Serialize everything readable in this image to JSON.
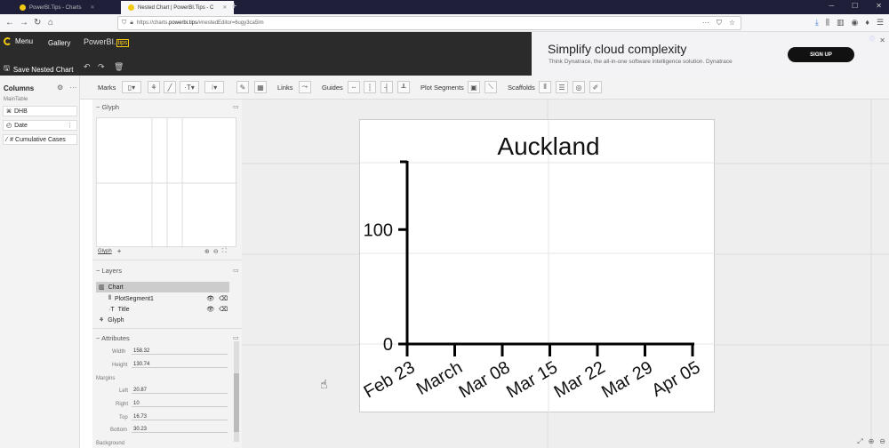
{
  "browser": {
    "tabs": [
      {
        "title": "PowerBI.Tips - Charts",
        "active": false
      },
      {
        "title": "Nested Chart | PowerBI.Tips - C",
        "active": true
      }
    ],
    "url_prefix": "https://charts.",
    "url_domain": "powerbi.tips",
    "url_path": "/#nestedEditor=6ugy3ca5lm",
    "url_more": "···"
  },
  "app": {
    "menu_label": "Menu",
    "gallery_label": "Gallery",
    "brand_main": "PowerBI.",
    "brand_tips": "tips",
    "save_label": "Save Nested Chart"
  },
  "ad": {
    "title": "Simplify cloud complexity",
    "subtitle": "Think Dynatrace, the all-in-one software intelligence solution. Dynatrace",
    "button": "SIGN UP"
  },
  "columns": {
    "header": "Columns",
    "table": "MainTable",
    "fields": [
      {
        "label": "DHB",
        "icon": "text-column-icon"
      },
      {
        "label": "Date",
        "icon": "date-column-icon"
      },
      {
        "label": "# Cumulative Cases",
        "icon": "numeric-column-icon"
      }
    ]
  },
  "toolbar": {
    "marks": "Marks",
    "links": "Links",
    "guides": "Guides",
    "plot_segments": "Plot Segments",
    "scaffolds": "Scaffolds"
  },
  "glyph_panel": {
    "title": "Glyph",
    "tab_label": "Glyph",
    "add": "+"
  },
  "layers_panel": {
    "title": "Layers",
    "items": [
      {
        "label": "Chart",
        "selected": true
      },
      {
        "label": "PlotSegment1",
        "selected": false
      },
      {
        "label": "Title",
        "selected": false
      },
      {
        "label": "Glyph",
        "selected": false
      }
    ]
  },
  "attributes_panel": {
    "title": "Attributes",
    "width_label": "Width",
    "width_value": "158.32",
    "height_label": "Height",
    "height_value": "130.74",
    "margins_label": "Margins",
    "left_label": "Left",
    "left_value": "20.87",
    "right_label": "Right",
    "right_value": "10",
    "top_label": "Top",
    "top_value": "16.73",
    "bottom_label": "Bottom",
    "bottom_value": "30.23",
    "background_label": "Background"
  },
  "chart_data": {
    "type": "line",
    "title": "Auckland",
    "xlabel": "",
    "ylabel": "",
    "x_ticks": [
      "Feb 23",
      "March",
      "Mar 08",
      "Mar 15",
      "Mar 22",
      "Mar 29",
      "Apr 05"
    ],
    "y_ticks": [
      0,
      100
    ],
    "ylim": [
      0,
      160
    ],
    "series": [],
    "grid": true
  }
}
